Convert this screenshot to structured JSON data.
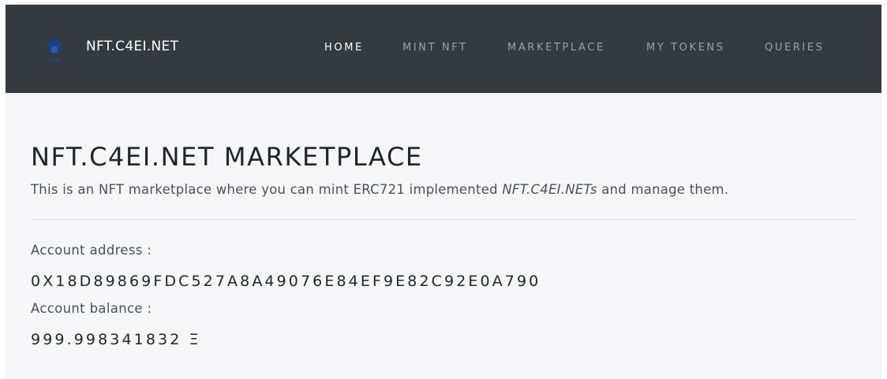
{
  "header": {
    "brand_name": "NFT.C4EI.NET",
    "logo_text": "C4EI",
    "logo_icon": "house-logo-icon",
    "nav": [
      {
        "label": "HOME",
        "active": true
      },
      {
        "label": "MINT NFT",
        "active": false
      },
      {
        "label": "MARKETPLACE",
        "active": false
      },
      {
        "label": "MY TOKENS",
        "active": false
      },
      {
        "label": "QUERIES",
        "active": false
      }
    ]
  },
  "main": {
    "title": "NFT.C4EI.NET MARKETPLACE",
    "lead_prefix": "This is an NFT marketplace where you can mint ERC721 implemented ",
    "lead_emphasis": "NFT.C4EI.NETs",
    "lead_suffix": " and manage them.",
    "account_address_label": "Account address :",
    "account_address": "0X18D89869FDC527A8A49076E84EF9E82C92E0A790",
    "account_balance_label": "Account balance :",
    "account_balance": "999.998341832 Ξ"
  },
  "colors": {
    "navbar": "#343a40",
    "page_background": "#f6f6f8",
    "logo_blue": "#1f4e9c"
  }
}
